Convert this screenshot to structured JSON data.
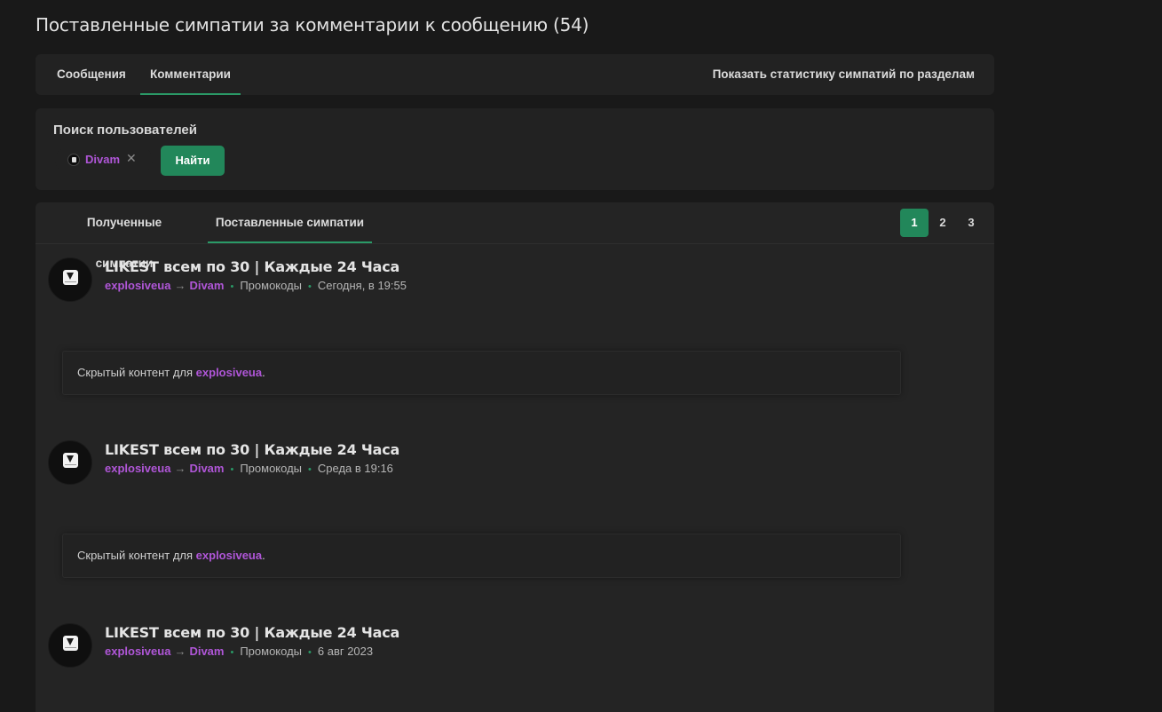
{
  "page_title": "Поставленные симпатии за комментарии к сообщению (54)",
  "tabs": {
    "messages": "Сообщения",
    "comments": "Комментарии",
    "stats_link": "Показать статистику симпатий по разделам"
  },
  "search": {
    "label": "Поиск пользователей",
    "token_user": "Divam",
    "remove_glyph": "✕",
    "button": "Найти"
  },
  "subtabs": {
    "received": "Полученные симпатии",
    "given": "Поставленные симпатии"
  },
  "pagination": [
    "1",
    "2",
    "3"
  ],
  "items": [
    {
      "title": "LIKEST всем по 30 | Каждые 24 Часа",
      "from": "explosiveua",
      "to": "Divam",
      "section": "Промокоды",
      "date": "Сегодня, в 19:55",
      "hidden_prefix": "Скрытый контент для ",
      "hidden_user": "explosiveua",
      "hidden_suffix": "."
    },
    {
      "title": "LIKEST всем по 30 | Каждые 24 Часа",
      "from": "explosiveua",
      "to": "Divam",
      "section": "Промокоды",
      "date": "Среда в 19:16",
      "hidden_prefix": "Скрытый контент для ",
      "hidden_user": "explosiveua",
      "hidden_suffix": "."
    },
    {
      "title": "LIKEST всем по 30 | Каждые 24 Часа",
      "from": "explosiveua",
      "to": "Divam",
      "section": "Промокоды",
      "date": "6 авг 2023"
    }
  ],
  "colors": {
    "accent_green": "#22875a",
    "username_purple": "#b056d8"
  },
  "icons": {
    "arrow": "→",
    "separator": "•"
  }
}
